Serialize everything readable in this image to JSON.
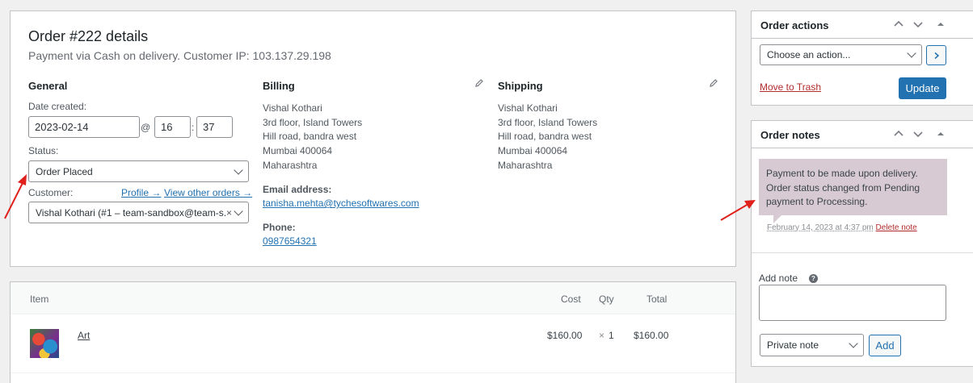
{
  "order": {
    "title": "Order #222 details",
    "subtitle": "Payment via Cash on delivery. Customer IP: 103.137.29.198",
    "general": {
      "heading": "General",
      "date_label": "Date created:",
      "date_value": "2023-02-14",
      "at_symbol": "@",
      "hour": "16",
      "time_sep": ":",
      "minute": "37",
      "status_label": "Status:",
      "status_value": "Order Placed",
      "customer_label": "Customer:",
      "profile_link": "Profile →",
      "other_orders_link": "View other orders →",
      "customer_value": "Vishal Kothari (#1 – team-sandbox@team-s...",
      "clear_symbol": "×"
    },
    "billing": {
      "heading": "Billing",
      "name": "Vishal Kothari",
      "line1": "3rd floor, Island Towers",
      "line2": "Hill road, bandra west",
      "city": "Mumbai 400064",
      "state": "Maharashtra",
      "email_label": "Email address:",
      "email": "tanisha.mehta@tychesoftwares.com",
      "phone_label": "Phone:",
      "phone": "0987654321"
    },
    "shipping": {
      "heading": "Shipping",
      "name": "Vishal Kothari",
      "line1": "3rd floor, Island Towers",
      "line2": "Hill road, bandra west",
      "city": "Mumbai 400064",
      "state": "Maharashtra"
    }
  },
  "items": {
    "headers": {
      "item": "Item",
      "cost": "Cost",
      "qty": "Qty",
      "total": "Total"
    },
    "rows": [
      {
        "name": "Art",
        "cost": "$160.00",
        "qty_prefix": "×",
        "qty": "1",
        "total": "$160.00"
      }
    ]
  },
  "order_actions": {
    "title": "Order actions",
    "select_value": "Choose an action...",
    "trash_link": "Move to Trash",
    "update_button": "Update"
  },
  "order_notes": {
    "title": "Order notes",
    "note_text": "Payment to be made upon delivery. Order status changed from Pending payment to Processing.",
    "note_date": "February 14, 2023 at 4:37 pm",
    "delete_link": "Delete note",
    "add_note_label": "Add note",
    "help_symbol": "?",
    "note_type": "Private note",
    "add_button": "Add"
  },
  "colors": {
    "accent": "#2271b1",
    "note_bg": "#d7cad2",
    "arrow": "#e0201b",
    "danger": "#b32d2e"
  }
}
